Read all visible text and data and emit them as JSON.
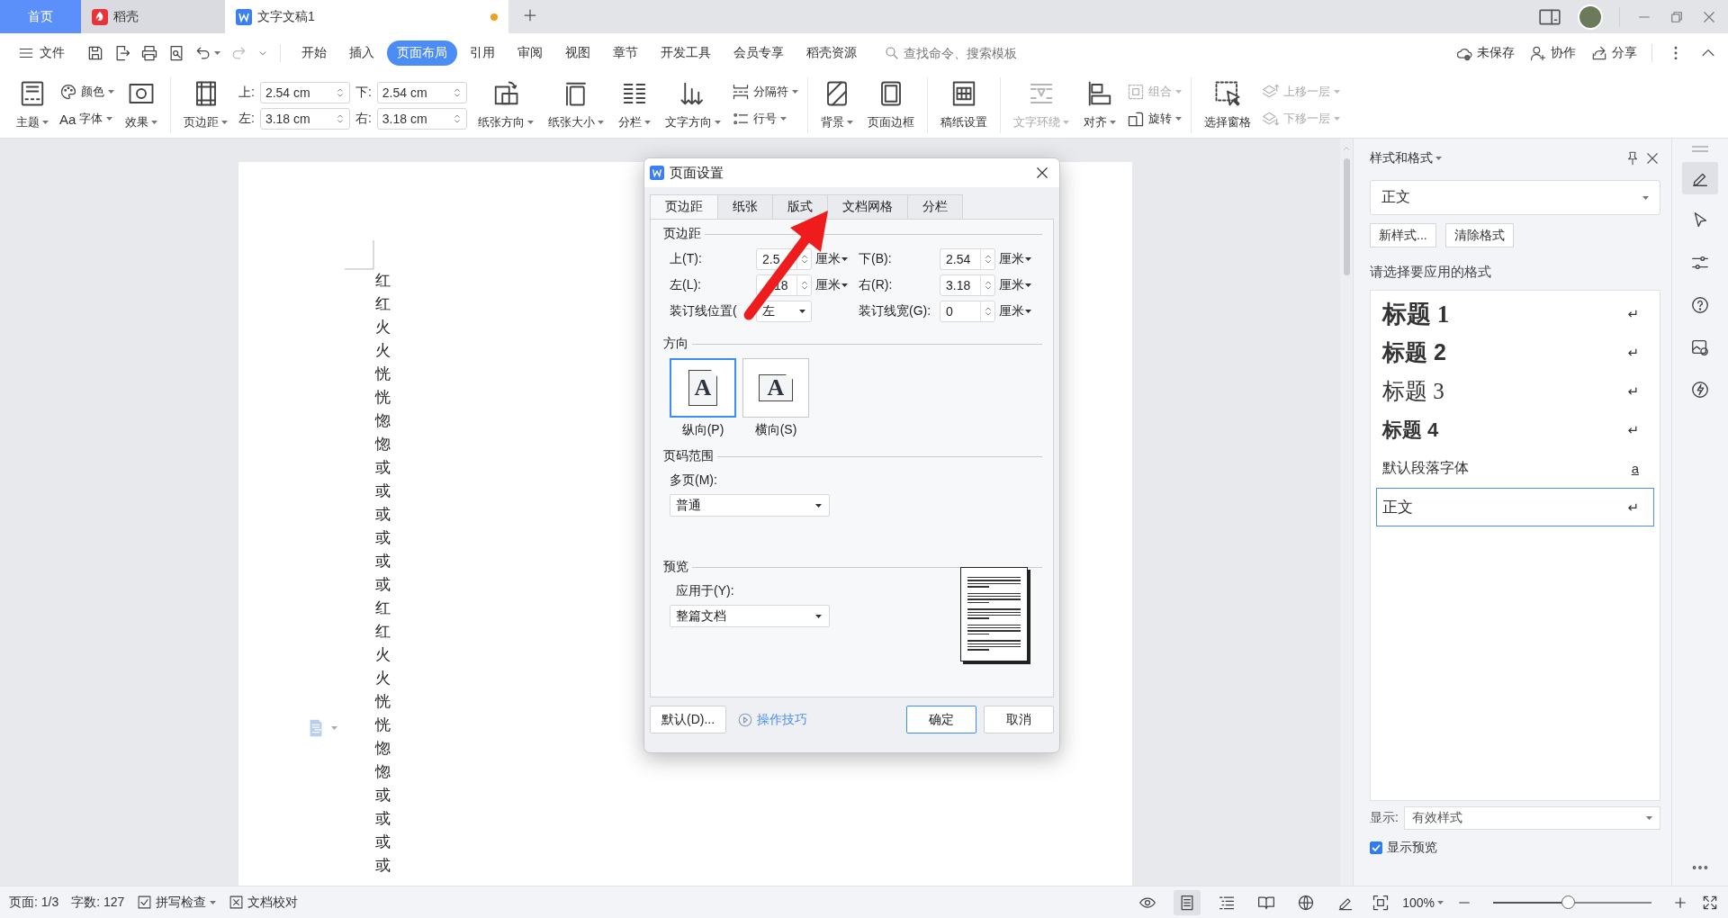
{
  "tabs": [
    {
      "label": "首页",
      "kind": "home",
      "selected": false,
      "modified": false
    },
    {
      "label": "稻壳",
      "kind": "docer",
      "selected": false,
      "modified": false
    },
    {
      "label": "文字文稿1",
      "kind": "doc",
      "selected": true,
      "modified": true
    }
  ],
  "menu": {
    "file": "文件",
    "items": [
      {
        "label": "开始",
        "selected": false
      },
      {
        "label": "插入",
        "selected": false
      },
      {
        "label": "页面布局",
        "selected": true
      },
      {
        "label": "引用",
        "selected": false
      },
      {
        "label": "审阅",
        "selected": false
      },
      {
        "label": "视图",
        "selected": false
      },
      {
        "label": "章节",
        "selected": false
      },
      {
        "label": "开发工具",
        "selected": false
      },
      {
        "label": "会员专享",
        "selected": false
      },
      {
        "label": "稻壳资源",
        "selected": false
      }
    ],
    "search": {
      "placeholder": "查找命令、搜索模板"
    },
    "actions": [
      {
        "label": "未保存",
        "kind": "cloud"
      },
      {
        "label": "协作",
        "kind": "collab"
      },
      {
        "label": "分享",
        "kind": "share"
      }
    ]
  },
  "ribbon": [
    {
      "items": [
        {
          "kind": "big",
          "label": "主题",
          "disabled": false,
          "dropdown": true
        },
        {
          "kind": "pair",
          "items": [
            {
              "label": "颜色",
              "disabled": false,
              "dropdown": true
            },
            {
              "label": "字体",
              "icon_text": "Aa",
              "disabled": false,
              "dropdown": true
            }
          ]
        },
        {
          "kind": "big",
          "label": "效果",
          "disabled": false,
          "dropdown": true
        }
      ]
    },
    {
      "items": [
        {
          "kind": "big",
          "label": "页边距",
          "disabled": false,
          "dropdown": true
        },
        {
          "kind": "margins",
          "fields": [
            {
              "label": "上:",
              "value": "2.54 cm"
            },
            {
              "label": "下:",
              "value": "2.54 cm"
            },
            {
              "label": "左:",
              "value": "3.18 cm"
            },
            {
              "label": "右:",
              "value": "3.18 cm"
            }
          ]
        },
        {
          "kind": "big",
          "label": "纸张方向",
          "disabled": false,
          "dropdown": true
        },
        {
          "kind": "big",
          "label": "纸张大小",
          "disabled": false,
          "dropdown": true
        },
        {
          "kind": "big",
          "label": "分栏",
          "disabled": false,
          "dropdown": true
        },
        {
          "kind": "big",
          "label": "文字方向",
          "disabled": false,
          "dropdown": true
        },
        {
          "kind": "pair",
          "items": [
            {
              "label": "分隔符",
              "disabled": false,
              "dropdown": true
            },
            {
              "label": "行号",
              "disabled": false,
              "dropdown": true
            }
          ]
        }
      ]
    },
    {
      "items": [
        {
          "kind": "big",
          "label": "背景",
          "disabled": false,
          "dropdown": true
        },
        {
          "kind": "big",
          "label": "页面边框",
          "disabled": false,
          "dropdown": false
        }
      ]
    },
    {
      "items": [
        {
          "kind": "big",
          "label": "稿纸设置",
          "disabled": false,
          "dropdown": false
        }
      ]
    },
    {
      "items": [
        {
          "kind": "big",
          "label": "文字环绕",
          "disabled": true,
          "dropdown": true
        },
        {
          "kind": "big",
          "label": "对齐",
          "disabled": false,
          "dropdown": true
        },
        {
          "kind": "pair",
          "items": [
            {
              "label": "组合",
              "disabled": true,
              "dropdown": true
            },
            {
              "label": "旋转",
              "disabled": false,
              "dropdown": true
            }
          ]
        }
      ]
    },
    {
      "items": [
        {
          "kind": "big",
          "label": "选择窗格",
          "disabled": false,
          "dropdown": false
        },
        {
          "kind": "pair",
          "items": [
            {
              "label": "上移一层",
              "disabled": true,
              "dropdown": true
            },
            {
              "label": "下移一层",
              "disabled": true,
              "dropdown": true
            }
          ]
        }
      ]
    }
  ],
  "document": {
    "lines": [
      "红",
      "红",
      "火",
      "火",
      "恍",
      "恍",
      "惚",
      "惚",
      "或",
      "或",
      "或",
      "或",
      "或",
      "或",
      "红",
      "红",
      "火",
      "火",
      "恍",
      "恍",
      "惚",
      "惚",
      "或",
      "或",
      "或",
      "或"
    ]
  },
  "dialog": {
    "title": "页面设置",
    "tabs": [
      {
        "label": "页边距",
        "selected": true
      },
      {
        "label": "纸张",
        "selected": false
      },
      {
        "label": "版式",
        "selected": false
      },
      {
        "label": "文档网格",
        "selected": false
      },
      {
        "label": "分栏",
        "selected": false
      }
    ],
    "margins": {
      "heading": "页边距",
      "fields": [
        {
          "label": "上(T):",
          "value": "2.5",
          "kind": "spin",
          "unit": "厘米"
        },
        {
          "label": "下(B):",
          "value": "2.54",
          "kind": "spin",
          "unit": "厘米"
        },
        {
          "label": "左(L):",
          "value": "18",
          "kind": "spin",
          "unit": "厘米"
        },
        {
          "label": "右(R):",
          "value": "3.18",
          "kind": "spin",
          "unit": "厘米"
        },
        {
          "label": "装订线位置(",
          "value": "左",
          "kind": "select"
        },
        {
          "label": "装订线宽(G):",
          "value": "0",
          "kind": "spin",
          "unit": "厘米"
        }
      ]
    },
    "orientation": {
      "heading": "方向",
      "options": [
        {
          "label": "纵向(P)",
          "glyph": "A",
          "kind": "portrait",
          "selected": true
        },
        {
          "label": "横向(S)",
          "glyph": "A",
          "kind": "landscape",
          "selected": false
        }
      ]
    },
    "pages": {
      "heading": "页码范围",
      "label": "多页(M):",
      "value": "普通"
    },
    "preview": {
      "heading": "预览",
      "label": "应用于(Y):",
      "value": "整篇文档"
    },
    "footer": {
      "default": "默认(D)...",
      "tips": "操作技巧",
      "ok": "确定",
      "cancel": "取消"
    },
    "annotation": {
      "kind": "arrow"
    }
  },
  "panel": {
    "title": "样式和格式",
    "current": "正文",
    "buttons": [
      "新样式...",
      "清除格式"
    ],
    "prompt": "请选择要应用的格式",
    "styles": [
      {
        "label": "标题 1",
        "kind": "heading1",
        "marker": "↵",
        "selected": false
      },
      {
        "label": "标题 2",
        "kind": "heading2",
        "marker": "↵",
        "selected": false
      },
      {
        "label": "标题 3",
        "kind": "heading3",
        "marker": "↵",
        "selected": false
      },
      {
        "label": "标题 4",
        "kind": "heading4",
        "marker": "↵",
        "selected": false
      },
      {
        "label": "默认段落字体",
        "kind": "character",
        "marker": "a",
        "selected": false
      },
      {
        "label": "正文",
        "kind": "body",
        "marker": "↵",
        "selected": true
      }
    ],
    "show_label": "显示:",
    "show_value": "有效样式",
    "preview": {
      "label": "显示预览",
      "checked": true
    }
  },
  "sidebar": [
    {
      "kind": "pen",
      "selected": true
    },
    {
      "kind": "cursor",
      "selected": false
    },
    {
      "kind": "sliders",
      "selected": false
    },
    {
      "kind": "help",
      "selected": false
    },
    {
      "kind": "image",
      "selected": false
    },
    {
      "kind": "bolt",
      "selected": false
    }
  ],
  "status": {
    "page": "页面: 1/3",
    "words": "字数: 127",
    "tools": [
      {
        "label": "拼写检查",
        "kind": "check",
        "dropdown": true
      },
      {
        "label": "文档校对",
        "kind": "proof",
        "dropdown": false
      }
    ],
    "views": [
      {
        "kind": "eye",
        "selected": false
      },
      {
        "kind": "page",
        "selected": true
      },
      {
        "kind": "outline",
        "selected": false
      },
      {
        "kind": "book",
        "selected": false
      },
      {
        "kind": "web",
        "selected": false
      },
      {
        "kind": "pen",
        "selected": false
      }
    ],
    "zoom": {
      "value": "100%",
      "level": 0.47
    }
  }
}
